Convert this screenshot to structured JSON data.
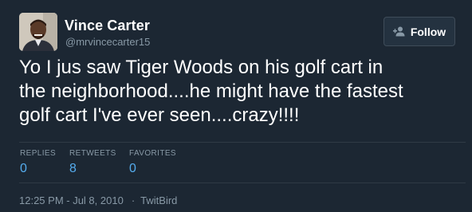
{
  "user": {
    "name": "Vince Carter",
    "handle": "@mrvincecarter15"
  },
  "follow_button": {
    "label": "Follow",
    "icon": "person-add-icon"
  },
  "tweet": {
    "lines": [
      "Yo I jus saw Tiger Woods on his golf cart in",
      "the neighborhood....he might have the fastest",
      "golf cart I've ever seen....crazy!!!!"
    ]
  },
  "stats": {
    "replies_label": "REPLIES",
    "replies": "0",
    "retweets_label": "RETWEETS",
    "retweets": "8",
    "favorites_label": "FAVORITES",
    "favorites": "0"
  },
  "meta": {
    "timestamp": "12:25 PM - Jul 8, 2010",
    "separator": "·",
    "source": "TwitBird"
  },
  "colors": {
    "background": "#1c2733",
    "secondary_text": "#8899a6",
    "accent": "#55acee",
    "divider": "#2f3a45"
  }
}
